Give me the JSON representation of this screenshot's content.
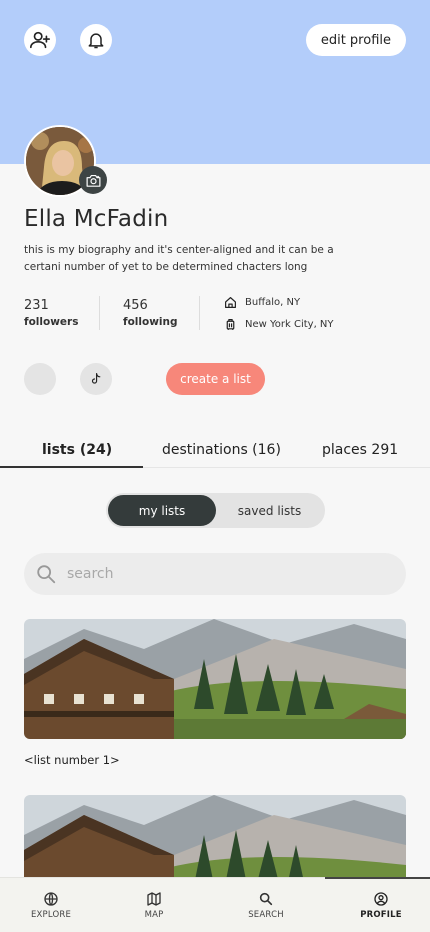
{
  "header": {
    "edit_profile_label": "edit profile"
  },
  "profile": {
    "name": "Ella McFadin",
    "bio": "this is my biography and it's center-aligned and it can be a certani number of yet to be determined chacters long",
    "followers_count": "231",
    "followers_label": "followers",
    "following_count": "456",
    "following_label": "following",
    "hometown": "Buffalo, NY",
    "current_city": "New York City, NY"
  },
  "actions": {
    "create_list_label": "create a list"
  },
  "tabs": [
    {
      "label": "lists (24)",
      "active": true
    },
    {
      "label": "destinations (16)",
      "active": false
    },
    {
      "label": "places 291",
      "active": false
    }
  ],
  "segment": {
    "options": [
      "my lists",
      "saved lists"
    ],
    "selected": "my lists"
  },
  "search": {
    "placeholder": "search"
  },
  "lists": [
    {
      "title": "<list number 1>"
    },
    {
      "title": ""
    }
  ],
  "bottom_nav": [
    {
      "label": "EXPLORE",
      "icon": "globe-icon"
    },
    {
      "label": "MAP",
      "icon": "map-icon"
    },
    {
      "label": "SEARCH",
      "icon": "search-icon"
    },
    {
      "label": "PROFILE",
      "icon": "user-circle-icon",
      "active": true
    }
  ],
  "colors": {
    "cover": "#b3cdfa",
    "accent": "#f7877a",
    "segment_active": "#343b3b",
    "background": "#f7f7f7"
  }
}
